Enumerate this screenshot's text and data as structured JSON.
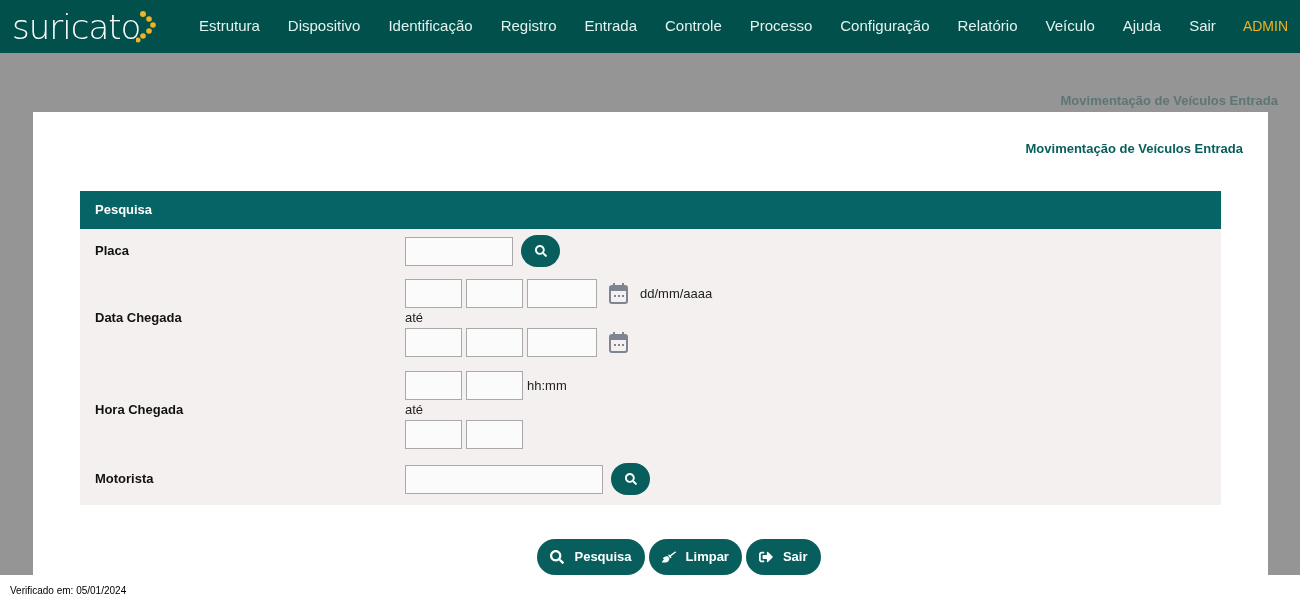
{
  "nav": {
    "logo": "suricato",
    "items": [
      "Estrutura",
      "Dispositivo",
      "Identificação",
      "Registro",
      "Entrada",
      "Controle",
      "Processo",
      "Configuração",
      "Relatório",
      "Veículo",
      "Ajuda",
      "Sair"
    ],
    "user": "ADMIN"
  },
  "page_title": "Movimentação de Veículos Entrada",
  "card_title": "Movimentação de Veículos Entrada",
  "panel": {
    "title": "Pesquisa",
    "rows": [
      {
        "label": "Placa",
        "kind": "lookup"
      },
      {
        "label": "Data Chegada",
        "kind": "date_range",
        "hint": "dd/mm/aaaa",
        "separator": "até"
      },
      {
        "label": "Hora Chegada",
        "kind": "time_range",
        "hint": "hh:mm",
        "separator": "até"
      },
      {
        "label": "Motorista",
        "kind": "lookup_wide"
      }
    ]
  },
  "buttons": [
    {
      "label": "Pesquisa",
      "kind": "search"
    },
    {
      "label": "Limpar",
      "kind": "clear"
    },
    {
      "label": "Sair",
      "kind": "exit"
    }
  ],
  "footer": "Verificado em: 05/01/2024"
}
